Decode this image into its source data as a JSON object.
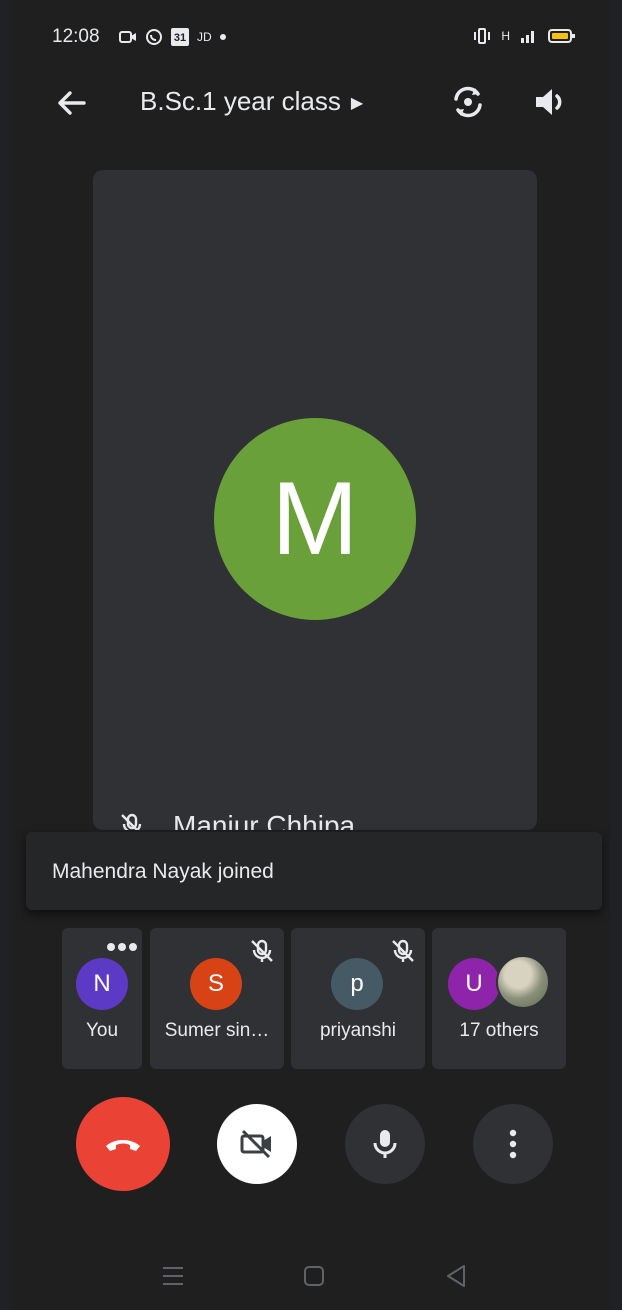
{
  "status_bar": {
    "time": "12:08",
    "calendar_day": "31",
    "carrier_text": "JD",
    "signal_text": "H"
  },
  "header": {
    "title": "B.Sc.1 year class",
    "icons": [
      "back-arrow-icon",
      "caret-right-icon",
      "switch-camera-icon",
      "speaker-icon"
    ]
  },
  "main_tile": {
    "initial": "M",
    "name": "Manjur Chhipa",
    "avatar_color": "#6aa03a"
  },
  "toast": {
    "message": "Mahendra Nayak joined"
  },
  "participants": [
    {
      "initial": "N",
      "label": "You",
      "color": "#5c3ac6"
    },
    {
      "initial": "S",
      "label": "Sumer sin…",
      "color": "#d84315"
    },
    {
      "initial": "p",
      "label": "priyanshi",
      "color": "#455a64"
    },
    {
      "initial": "U",
      "label": "17 others",
      "color": "#8e24aa"
    }
  ],
  "controls": {
    "end_call_color": "#ea4335",
    "icons": [
      "end-call-icon",
      "video-off-icon",
      "microphone-icon",
      "more-options-icon"
    ]
  },
  "nav_bar": {
    "icons": [
      "recents-icon",
      "home-icon",
      "back-nav-icon"
    ]
  }
}
